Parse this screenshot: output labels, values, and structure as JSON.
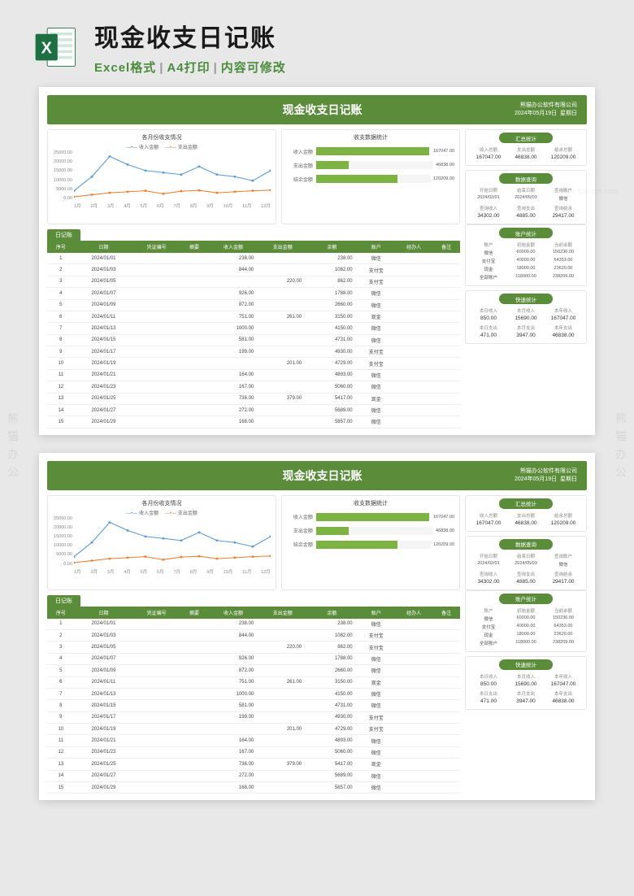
{
  "watermark": "熊猫办公",
  "url_wm": "www.tukuppt.com",
  "banner": {
    "title": "现金收支日记账",
    "sub1": "Excel格式",
    "sub2": "A4打印",
    "sub3": "内容可修改"
  },
  "header": {
    "title": "现金收支日记账",
    "company": "熊猫办公软件有限公司",
    "date": "2024年05月19日",
    "weekday": "星期日"
  },
  "chart_data": [
    {
      "type": "line",
      "title": "各月份收支情况",
      "legend": [
        "收入金额",
        "支出金额"
      ],
      "categories": [
        "1月",
        "2月",
        "3月",
        "4月",
        "5月",
        "6月",
        "7月",
        "8月",
        "9月",
        "10月",
        "11月",
        "12月"
      ],
      "series": [
        {
          "name": "收入金额",
          "color": "#5b9bd5",
          "values": [
            5000,
            12000,
            22000,
            18000,
            15000,
            14000,
            13000,
            17000,
            13000,
            12000,
            10000,
            15000
          ]
        },
        {
          "name": "支出金额",
          "color": "#ed7d31",
          "values": [
            2000,
            3000,
            4000,
            4500,
            5000,
            3500,
            4800,
            5200,
            4000,
            4500,
            5000,
            5300
          ]
        }
      ],
      "ylim": [
        0,
        25000
      ],
      "yticks": [
        0,
        5000,
        10000,
        15000,
        20000,
        25000
      ],
      "xlabel": "",
      "ylabel": ""
    },
    {
      "type": "bar_h",
      "title": "收支数据统计",
      "items": [
        {
          "label": "收入金额",
          "value": 167047.0
        },
        {
          "label": "支出金额",
          "value": 46838.0
        },
        {
          "label": "结余金额",
          "value": 120209.0
        }
      ],
      "xlim": [
        0,
        170000
      ]
    }
  ],
  "side": {
    "summary": {
      "title": "汇总统计",
      "head": [
        "收入总额",
        "支出总额",
        "结余总额"
      ],
      "vals": [
        "167047.00",
        "46838.00",
        "120209.00"
      ]
    },
    "query": {
      "title": "数据查询",
      "head": [
        "开始日期",
        "结束日期",
        "查询账户"
      ],
      "vals": [
        "2024/02/01",
        "2024/05/03",
        "微信"
      ],
      "head2": [
        "查询收入",
        "查询支出",
        "查询结余"
      ],
      "vals2": [
        "34302.00",
        "4885.00",
        "29417.00"
      ]
    },
    "account": {
      "title": "账户统计",
      "head": [
        "账户",
        "初始金额",
        "当前余额"
      ],
      "rows": [
        [
          "微信",
          "60000.00",
          "150236.00"
        ],
        [
          "支付宝",
          "40000.00",
          "64353.00"
        ],
        [
          "现金",
          "18000.00",
          "23620.00"
        ],
        [
          "全部账户",
          "118000.00",
          "238209.00"
        ]
      ]
    },
    "quick": {
      "title": "快速统计",
      "head1": [
        "本日收入",
        "本月收入",
        "本年收入"
      ],
      "vals1": [
        "850.00",
        "15690.00",
        "167047.00"
      ],
      "head2": [
        "本日支出",
        "本月支出",
        "本年支出"
      ],
      "vals2": [
        "471.00",
        "3947.00",
        "46838.00"
      ]
    }
  },
  "journal_label": "日记账",
  "table": {
    "columns": [
      "序号",
      "日期",
      "凭证编号",
      "摘要",
      "收入金额",
      "支出金额",
      "余额",
      "账户",
      "经办人",
      "备注"
    ],
    "rows": [
      [
        "1",
        "2024/01/01",
        "",
        "",
        "238.00",
        "",
        "238.00",
        "微信",
        "",
        ""
      ],
      [
        "2",
        "2024/01/03",
        "",
        "",
        "844.00",
        "",
        "1082.00",
        "支付宝",
        "",
        ""
      ],
      [
        "3",
        "2024/01/05",
        "",
        "",
        "",
        "220.00",
        "862.00",
        "支付宝",
        "",
        ""
      ],
      [
        "4",
        "2024/01/07",
        "",
        "",
        "926.00",
        "",
        "1788.00",
        "微信",
        "",
        ""
      ],
      [
        "5",
        "2024/01/09",
        "",
        "",
        "872.00",
        "",
        "2660.00",
        "微信",
        "",
        ""
      ],
      [
        "6",
        "2024/01/11",
        "",
        "",
        "751.00",
        "261.00",
        "3150.00",
        "现金",
        "",
        ""
      ],
      [
        "7",
        "2024/01/13",
        "",
        "",
        "1000.00",
        "",
        "4150.00",
        "微信",
        "",
        ""
      ],
      [
        "8",
        "2024/01/15",
        "",
        "",
        "581.00",
        "",
        "4731.00",
        "微信",
        "",
        ""
      ],
      [
        "9",
        "2024/01/17",
        "",
        "",
        "199.00",
        "",
        "4930.00",
        "支付宝",
        "",
        ""
      ],
      [
        "10",
        "2024/01/19",
        "",
        "",
        "",
        "201.00",
        "4729.00",
        "支付宝",
        "",
        ""
      ],
      [
        "11",
        "2024/01/21",
        "",
        "",
        "164.00",
        "",
        "4893.00",
        "微信",
        "",
        ""
      ],
      [
        "12",
        "2024/01/23",
        "",
        "",
        "167.00",
        "",
        "5060.00",
        "微信",
        "",
        ""
      ],
      [
        "13",
        "2024/01/25",
        "",
        "",
        "736.00",
        "379.00",
        "5417.00",
        "现金",
        "",
        ""
      ],
      [
        "14",
        "2024/01/27",
        "",
        "",
        "272.00",
        "",
        "5689.00",
        "微信",
        "",
        ""
      ],
      [
        "15",
        "2024/01/29",
        "",
        "",
        "168.00",
        "",
        "5857.00",
        "微信",
        "",
        ""
      ]
    ]
  }
}
